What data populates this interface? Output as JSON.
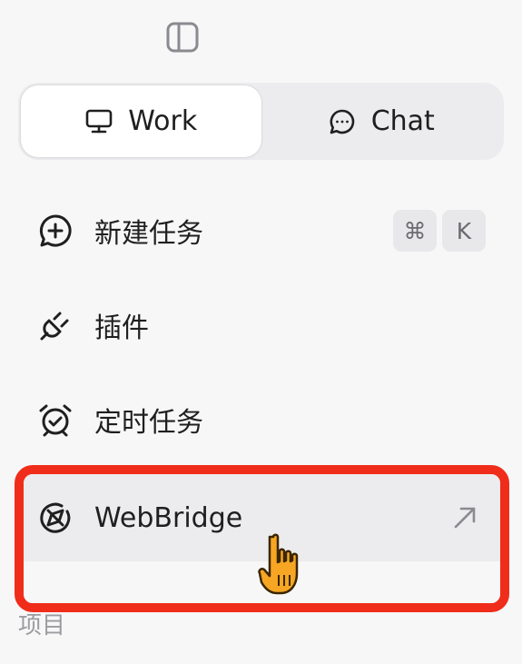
{
  "segmented": {
    "work_label": "Work",
    "chat_label": "Chat",
    "selected": "Work"
  },
  "nav": {
    "new_task": {
      "label": "新建任务",
      "shortcut": [
        "⌘",
        "K"
      ]
    },
    "plugins": {
      "label": "插件"
    },
    "scheduled": {
      "label": "定时任务"
    },
    "webbridge": {
      "label": "WebBridge",
      "external_icon": "arrow-up-right-icon"
    }
  },
  "section": {
    "projects_label": "项目"
  },
  "colors": {
    "background": "#f7f7f8",
    "highlight_border": "#f02d1a",
    "hover_bg": "#ececee",
    "cursor_fill": "#f7a623"
  }
}
